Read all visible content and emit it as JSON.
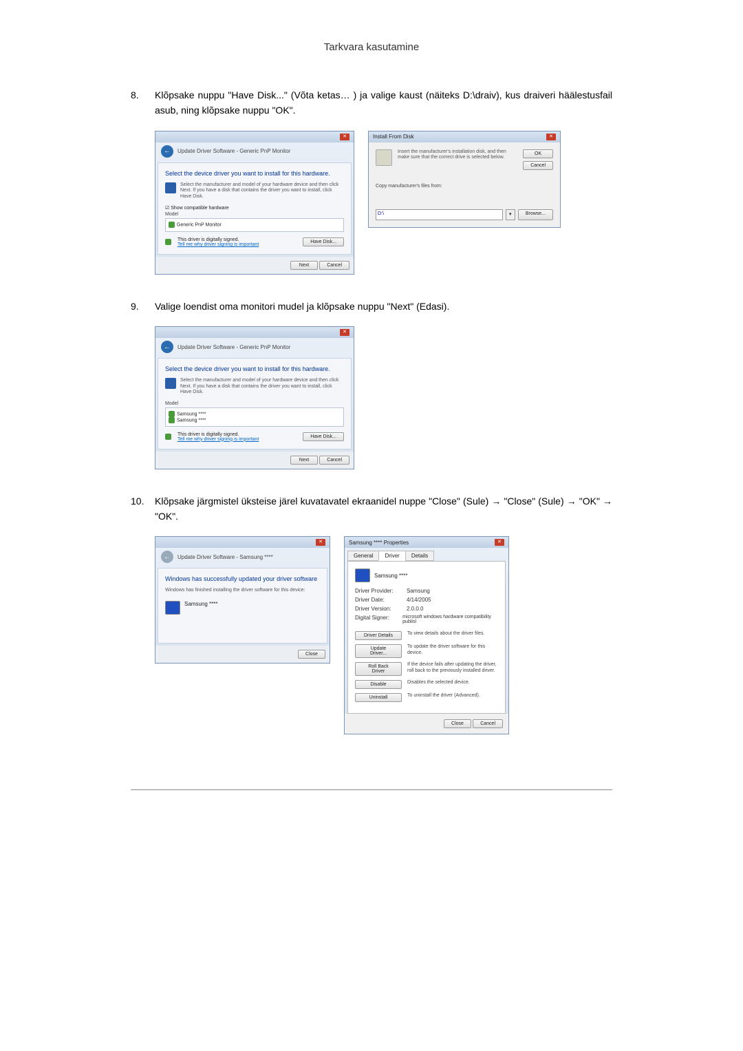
{
  "page_title": "Tarkvara kasutamine",
  "step8": {
    "num": "8.",
    "text": "Klõpsake nuppu \"Have Disk...\" (Võta ketas… ) ja valige kaust (näiteks D:\\draiv), kus draiveri häälestusfail asub, ning klõpsake nuppu \"OK\"."
  },
  "step9": {
    "num": "9.",
    "text": "Valige loendist oma monitori mudel ja klõpsake nuppu \"Next\" (Edasi)."
  },
  "step10": {
    "num": "10.",
    "text": "Klõpsake järgmistel üksteise järel kuvatavatel ekraanidel nuppe \"Close\" (Sule) → \"Close\" (Sule) → \"OK\" → \"OK\"."
  },
  "dlg_update1": {
    "title": "Update Driver Software - Generic PnP Monitor",
    "heading": "Select the device driver you want to install for this hardware.",
    "help": "Select the manufacturer and model of your hardware device and then click Next. If you have a disk that contains the driver you want to install, click Have Disk.",
    "chk": "Show compatible hardware",
    "model_lbl": "Model",
    "item": "Generic PnP Monitor",
    "signed": "This driver is digitally signed.",
    "link": "Tell me why driver signing is important",
    "have_disk": "Have Disk...",
    "next": "Next",
    "cancel": "Cancel"
  },
  "dlg_install": {
    "title": "Install From Disk",
    "text": "Insert the manufacturer's installation disk, and then make sure that the correct drive is selected below.",
    "ok": "OK",
    "cancel": "Cancel",
    "copy_lbl": "Copy manufacturer's files from:",
    "path": "D:\\",
    "browse": "Browse..."
  },
  "dlg_update2": {
    "title": "Update Driver Software - Generic PnP Monitor",
    "heading": "Select the device driver you want to install for this hardware.",
    "help": "Select the manufacturer and model of your hardware device and then click Next. If you have a disk that contains the driver you want to install, click Have Disk.",
    "model_lbl": "Model",
    "item1": "Samsung ****",
    "item2": "Samsung ****",
    "signed": "This driver is digitally signed.",
    "link": "Tell me why driver signing is important",
    "have_disk": "Have Disk...",
    "next": "Next",
    "cancel": "Cancel"
  },
  "dlg_success": {
    "title": "Update Driver Software - Samsung ****",
    "heading": "Windows has successfully updated your driver software",
    "sub": "Windows has finished installing the driver software for this device:",
    "item": "Samsung ****",
    "close": "Close"
  },
  "dlg_props": {
    "title": "Samsung **** Properties",
    "tab_general": "General",
    "tab_driver": "Driver",
    "tab_details": "Details",
    "device": "Samsung ****",
    "provider_lbl": "Driver Provider:",
    "provider_val": "Samsung",
    "date_lbl": "Driver Date:",
    "date_val": "4/14/2005",
    "version_lbl": "Driver Version:",
    "version_val": "2.0.0.0",
    "signer_lbl": "Digital Signer:",
    "signer_val": "microsoft windows hardware compatibility publisl",
    "btn_details": "Driver Details",
    "desc_details": "To view details about the driver files.",
    "btn_update": "Update Driver...",
    "desc_update": "To update the driver software for this device.",
    "btn_roll": "Roll Back Driver",
    "desc_roll": "If the device fails after updating the driver, roll back to the previously installed driver.",
    "btn_disable": "Disable",
    "desc_disable": "Disables the selected device.",
    "btn_uninstall": "Uninstall",
    "desc_uninstall": "To uninstall the driver (Advanced).",
    "close": "Close",
    "cancel": "Cancel"
  }
}
